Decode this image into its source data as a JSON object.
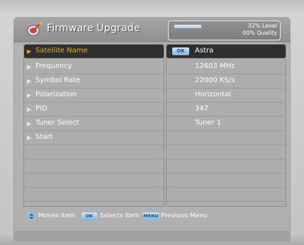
{
  "header": {
    "title": "Firmware Upgrade",
    "icon": "satellite-dish-icon",
    "signal": {
      "level_text": "32% Level",
      "quality_text": "00% Quality",
      "level_fraction": 0.32
    }
  },
  "settings": [
    {
      "label": "Satellite Name",
      "value": "Astra",
      "selected": true
    },
    {
      "label": "Frequency",
      "value": "12603 MHz"
    },
    {
      "label": "Symbol Rate",
      "value": "22000 KS/s"
    },
    {
      "label": "Polarization",
      "value": "Horizontal"
    },
    {
      "label": "PID",
      "value": "347"
    },
    {
      "label": "Tuner Select",
      "value": "Tuner 1"
    },
    {
      "label": "Start",
      "value": ""
    }
  ],
  "selected_value_badge": "OK",
  "footer": {
    "moves_text": "Moves Item",
    "ok_key": "OK",
    "selects_text": "Selects Item",
    "menu_key": "MENU",
    "previous_text": "Previous Menu"
  },
  "colors": {
    "accent": "#f0b000",
    "selection_bg": "#2f2f2f",
    "key_blue": "#7fb5de"
  }
}
